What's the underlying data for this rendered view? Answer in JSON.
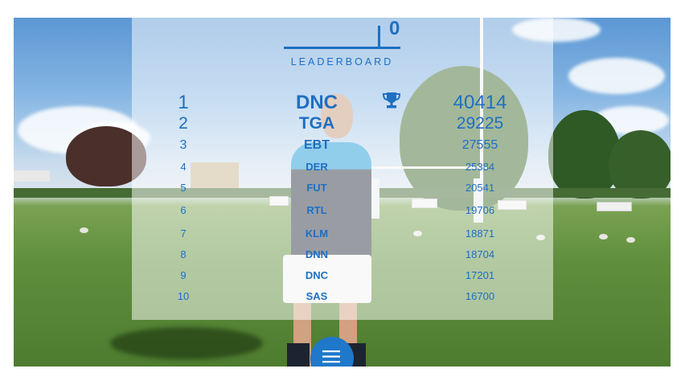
{
  "hud": {
    "score": "0",
    "title": "LEADERBOARD"
  },
  "leaderboard": [
    {
      "rank": "1",
      "name": "DNC",
      "score": "40414"
    },
    {
      "rank": "2",
      "name": "TGA",
      "score": "29225"
    },
    {
      "rank": "3",
      "name": "EBT",
      "score": "27555"
    },
    {
      "rank": "4",
      "name": "DER",
      "score": "25384"
    },
    {
      "rank": "5",
      "name": "FUT",
      "score": "20541"
    },
    {
      "rank": "6",
      "name": "RTL",
      "score": "19706"
    },
    {
      "rank": "7",
      "name": "KLM",
      "score": "18871"
    },
    {
      "rank": "8",
      "name": "DNN",
      "score": "18704"
    },
    {
      "rank": "9",
      "name": "DNC",
      "score": "17201"
    },
    {
      "rank": "10",
      "name": "SAS",
      "score": "16700"
    }
  ],
  "icons": {
    "trophy": "trophy-icon",
    "menu": "hamburger-menu-icon"
  },
  "colors": {
    "accent": "#1f6fc2",
    "menu_button": "#1f78c9"
  }
}
